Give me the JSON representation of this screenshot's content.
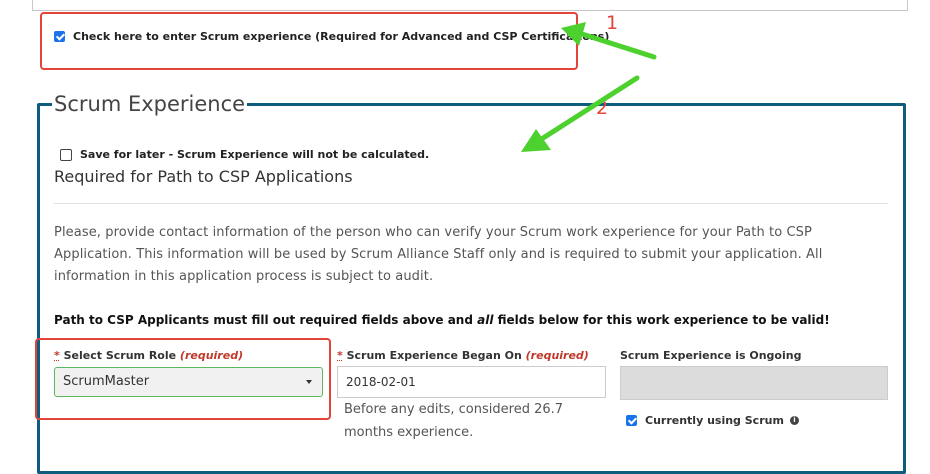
{
  "scrum_checkbox": {
    "checked": true,
    "label": "Check here to enter Scrum experience (Required for Advanced and CSP Certifications)"
  },
  "annotations": {
    "one": "1",
    "two": "2",
    "color": "#e3443a",
    "arrow_color": "#4cd12f"
  },
  "section": {
    "legend": "Scrum Experience",
    "save_for_later_label": "Save for later - Scrum Experience will not be calculated.",
    "heading": "Required for Path to CSP Applications",
    "description": "Please, provide contact information of the person who can verify your Scrum work experience for your Path to CSP Application. This information will be used by Scrum Alliance Staff only and is required to submit your application. All information in this application process is subject to audit.",
    "csp_note_prefix": "Path to CSP Applicants must fill out required fields above and ",
    "csp_note_italic": "all",
    "csp_note_suffix": " fields below for this work experience to be valid!",
    "border_color": "#0e5d7e"
  },
  "fields": {
    "role": {
      "star": "*",
      "label": "Select Scrum Role ",
      "required": "(required)",
      "value": "ScrumMaster"
    },
    "began": {
      "star": "*",
      "label": "Scrum Experience Began On ",
      "required": "(required)",
      "value": "2018-02-01",
      "hint": "Before any edits, considered 26.7 months experience."
    },
    "ongoing": {
      "label": "Scrum Experience is Ongoing",
      "value": ""
    },
    "currently_using": {
      "checked": true,
      "label": "Currently using Scrum",
      "info_icon": "i"
    }
  }
}
